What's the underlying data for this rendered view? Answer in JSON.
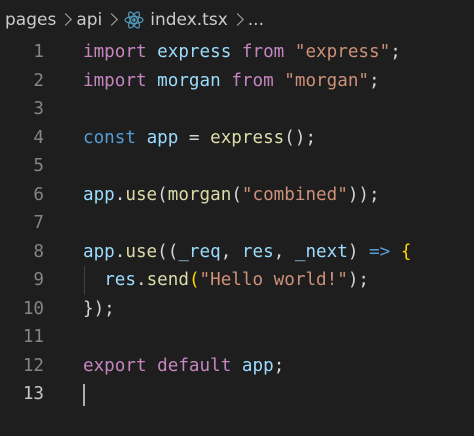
{
  "breadcrumb": {
    "items": [
      "pages",
      "api",
      "index.tsx",
      "..."
    ],
    "file_icon": "react-icon"
  },
  "colors": {
    "background": "#1e1e1e",
    "keyword_control": "#c586c0",
    "keyword": "#569cd6",
    "variable": "#9cdcfe",
    "function": "#dcdcaa",
    "string": "#ce9178",
    "line_number": "#858585",
    "react_icon": "#519aba"
  },
  "editor": {
    "line_numbers": [
      "1",
      "2",
      "3",
      "4",
      "5",
      "6",
      "7",
      "8",
      "9",
      "10",
      "11",
      "12",
      "13"
    ],
    "active_line": "13",
    "lines": [
      [
        [
          "import",
          "kw-import"
        ],
        [
          " ",
          "punc"
        ],
        [
          "express",
          "var"
        ],
        [
          " ",
          "punc"
        ],
        [
          "from",
          "kw-import"
        ],
        [
          " ",
          "punc"
        ],
        [
          "\"express\"",
          "str"
        ],
        [
          ";",
          "punc"
        ]
      ],
      [
        [
          "import",
          "kw-import"
        ],
        [
          " ",
          "punc"
        ],
        [
          "morgan",
          "var"
        ],
        [
          " ",
          "punc"
        ],
        [
          "from",
          "kw-import"
        ],
        [
          " ",
          "punc"
        ],
        [
          "\"morgan\"",
          "str"
        ],
        [
          ";",
          "punc"
        ]
      ],
      [],
      [
        [
          "const",
          "kw"
        ],
        [
          " ",
          "punc"
        ],
        [
          "app",
          "var"
        ],
        [
          " = ",
          "punc"
        ],
        [
          "express",
          "fn"
        ],
        [
          "();",
          "punc"
        ]
      ],
      [],
      [
        [
          "app",
          "var"
        ],
        [
          ".",
          "punc"
        ],
        [
          "use",
          "fn"
        ],
        [
          "(",
          "punc"
        ],
        [
          "morgan",
          "fn"
        ],
        [
          "(",
          "punc"
        ],
        [
          "\"combined\"",
          "str"
        ],
        [
          "));",
          "punc"
        ]
      ],
      [],
      [
        [
          "app",
          "var"
        ],
        [
          ".",
          "punc"
        ],
        [
          "use",
          "fn"
        ],
        [
          "((",
          "punc"
        ],
        [
          "_req",
          "var"
        ],
        [
          ", ",
          "punc"
        ],
        [
          "res",
          "var"
        ],
        [
          ", ",
          "punc"
        ],
        [
          "_next",
          "var"
        ],
        [
          ") ",
          "punc"
        ],
        [
          "=>",
          "kw"
        ],
        [
          " ",
          "punc"
        ],
        [
          "{",
          "brace1"
        ]
      ],
      [
        [
          "  ",
          "punc"
        ],
        [
          "res",
          "var"
        ],
        [
          ".",
          "punc"
        ],
        [
          "send",
          "fn"
        ],
        [
          "(",
          "brace1"
        ],
        [
          "\"Hello world!\"",
          "str"
        ],
        [
          ");",
          "punc"
        ]
      ],
      [
        [
          "});",
          "punc"
        ]
      ],
      [],
      [
        [
          "export",
          "kw-import"
        ],
        [
          " ",
          "punc"
        ],
        [
          "default",
          "kw-import"
        ],
        [
          " ",
          "punc"
        ],
        [
          "app",
          "var"
        ],
        [
          ";",
          "punc"
        ]
      ],
      []
    ]
  }
}
